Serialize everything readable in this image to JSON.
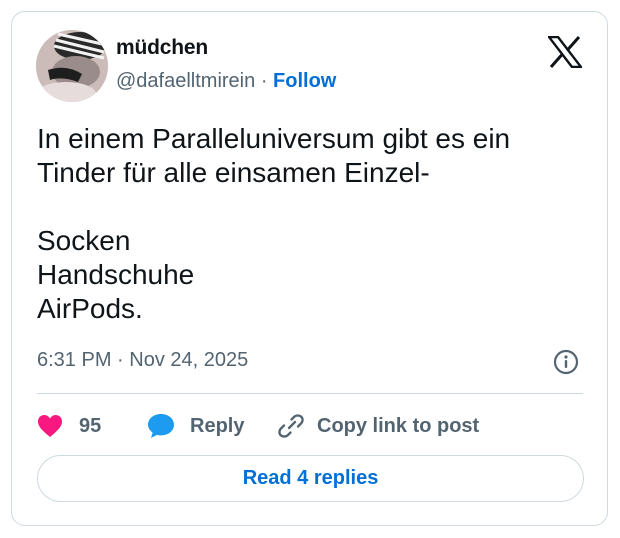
{
  "author": {
    "display_name": "müdchen",
    "handle": "@dafaelltmirein",
    "separator": "·",
    "follow_label": "Follow"
  },
  "tweet": {
    "text": "In einem Paralleluniversum gibt es ein\nTinder für alle einsamen Einzel-\n\nSocken\nHandschuhe\nAirPods.",
    "time": "6:31 PM",
    "date_separator": "·",
    "date": "Nov 24, 2025"
  },
  "actions": {
    "like_count": "95",
    "reply_label": "Reply",
    "copy_label": "Copy link to post"
  },
  "read_replies_label": "Read 4 replies",
  "icons": {
    "logo": "x-logo-icon",
    "info": "info-icon",
    "like": "heart-icon",
    "reply": "speech-bubble-icon",
    "copy": "link-icon"
  },
  "colors": {
    "accent": "#006fd6",
    "like": "#f91880",
    "reply_icon": "#1d9bf0",
    "text": "#0f1419",
    "muted": "#536471",
    "border": "#cfd9de"
  }
}
